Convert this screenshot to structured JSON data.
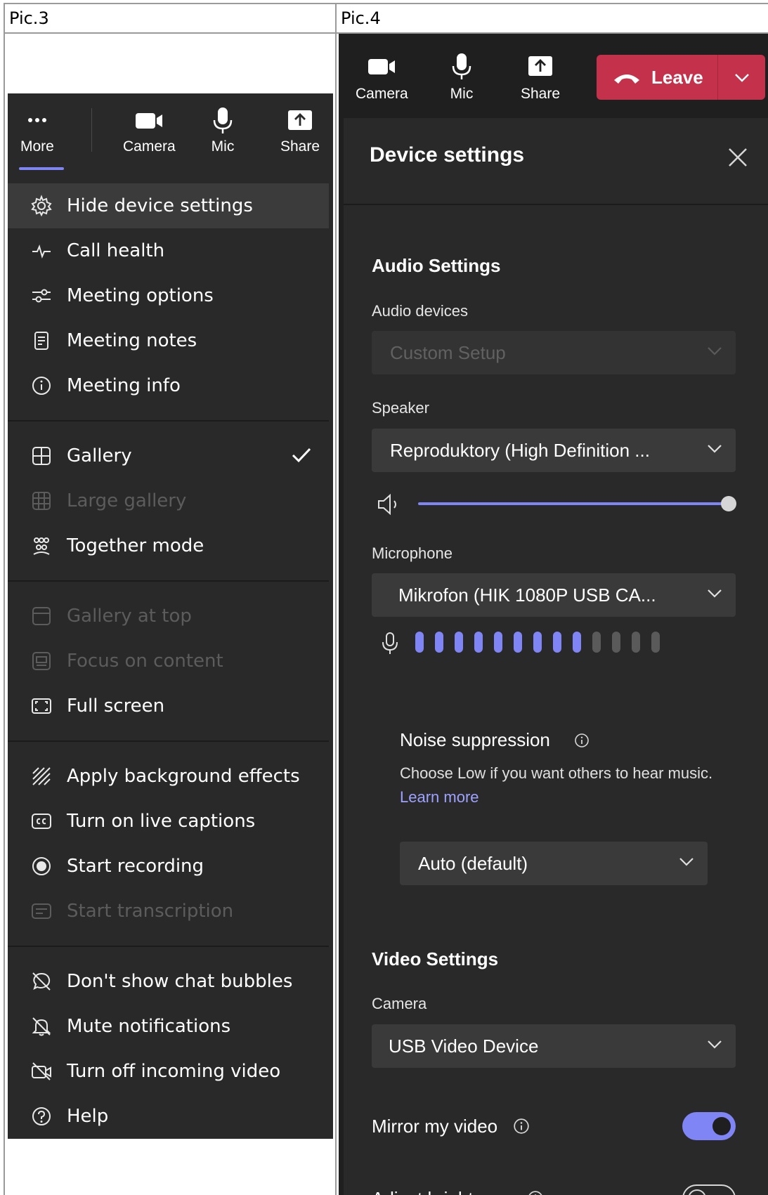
{
  "table": {
    "col1_header": "Pic.3",
    "col2_header": "Pic.4"
  },
  "pic3": {
    "toolbar": {
      "more": "More",
      "camera": "Camera",
      "mic": "Mic",
      "share": "Share"
    },
    "groups": [
      [
        {
          "label": "Hide device settings",
          "icon": "gear-icon",
          "state": "highlight"
        },
        {
          "label": "Call health",
          "icon": "pulse-icon",
          "state": "normal"
        },
        {
          "label": "Meeting options",
          "icon": "sliders-icon",
          "state": "normal"
        },
        {
          "label": "Meeting notes",
          "icon": "notes-icon",
          "state": "normal"
        },
        {
          "label": "Meeting info",
          "icon": "info-icon",
          "state": "normal"
        }
      ],
      [
        {
          "label": "Gallery",
          "icon": "gallery-icon",
          "state": "normal",
          "checked": true
        },
        {
          "label": "Large gallery",
          "icon": "large-gallery-icon",
          "state": "disabled"
        },
        {
          "label": "Together mode",
          "icon": "together-mode-icon",
          "state": "normal"
        }
      ],
      [
        {
          "label": "Gallery at top",
          "icon": "gallery-top-icon",
          "state": "disabled"
        },
        {
          "label": "Focus on content",
          "icon": "focus-content-icon",
          "state": "disabled"
        },
        {
          "label": "Full screen",
          "icon": "fullscreen-icon",
          "state": "normal"
        }
      ],
      [
        {
          "label": "Apply background effects",
          "icon": "background-effects-icon",
          "state": "normal"
        },
        {
          "label": "Turn on live captions",
          "icon": "captions-icon",
          "state": "normal"
        },
        {
          "label": "Start recording",
          "icon": "record-icon",
          "state": "normal"
        },
        {
          "label": "Start transcription",
          "icon": "transcription-icon",
          "state": "disabled"
        }
      ],
      [
        {
          "label": "Don't show chat bubbles",
          "icon": "chat-bubble-off-icon",
          "state": "normal"
        },
        {
          "label": "Mute notifications",
          "icon": "bell-off-icon",
          "state": "normal"
        },
        {
          "label": "Turn off incoming video",
          "icon": "video-off-icon",
          "state": "normal"
        },
        {
          "label": "Help",
          "icon": "help-icon",
          "state": "normal"
        }
      ]
    ]
  },
  "pic4": {
    "toolbar": {
      "camera": "Camera",
      "mic": "Mic",
      "share": "Share",
      "leave": "Leave"
    },
    "title": "Device settings",
    "audio": {
      "section": "Audio Settings",
      "devices_label": "Audio devices",
      "devices_value": "Custom Setup",
      "speaker_label": "Speaker",
      "speaker_value": "Reproduktory (High Definition ...",
      "volume_level": 1.0,
      "microphone_label": "Microphone",
      "microphone_value": "Mikrofon (HIK 1080P USB CA...",
      "mic_level_active": 9,
      "mic_level_total": 13,
      "noise_title": "Noise suppression",
      "noise_desc": "Choose Low if you want others to hear music.",
      "noise_link": "Learn more",
      "noise_value": "Auto (default)"
    },
    "video": {
      "section": "Video Settings",
      "camera_label": "Camera",
      "camera_value": "USB Video Device",
      "mirror_label": "Mirror my video",
      "mirror_on": true,
      "brightness_label": "Adjust brightness",
      "brightness_on": false
    },
    "colors": {
      "accent": "#7f85f5",
      "leave": "#c4314b",
      "panel": "#292929",
      "link": "#9ea2ff"
    }
  }
}
